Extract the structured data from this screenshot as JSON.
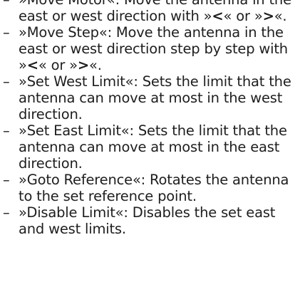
{
  "document": {
    "items": [
      {
        "label": "»Move Motor«",
        "description": ": Move the antenna in the east or west direction with »",
        "arrow_left": "<",
        "mid": "« or »",
        "arrow_right": ">",
        "end": "«."
      },
      {
        "label": "»Move Step«",
        "description": ": Move the antenna in the east or west direction step by step with »",
        "arrow_left": "<",
        "mid": "« or »",
        "arrow_right": ">",
        "end": "«."
      },
      {
        "label": "»Set West Limit«",
        "description": ": Sets the limit that the antenna can move at most in the west direction."
      },
      {
        "label": "»Set East Limit«",
        "description": ": Sets the limit that the antenna can move at most in the east direction."
      },
      {
        "label": "»Goto Reference«",
        "description": ": Rotates the antenna to the set reference point."
      },
      {
        "label": "»Disable Limit«",
        "description": ": Disables the set east and west limits."
      }
    ]
  }
}
